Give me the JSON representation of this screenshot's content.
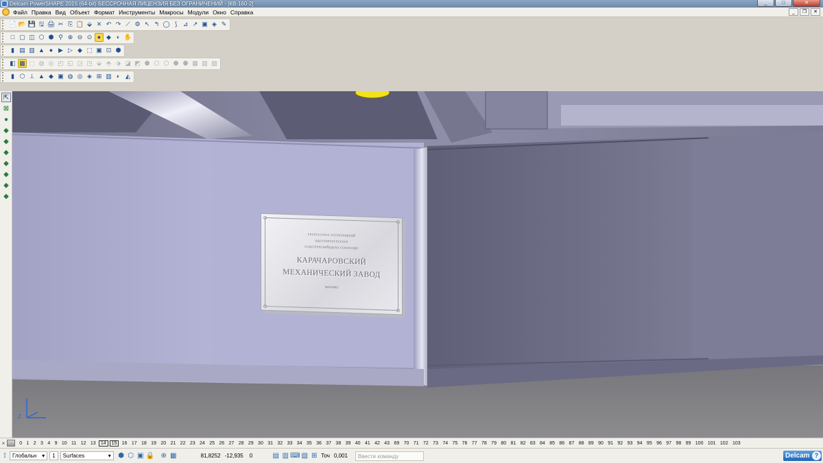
{
  "window": {
    "title": "Delcam PowerSHAPE 2015 (64-bit) БЕССРОЧНАЯ ЛИЦЕНЗИЯ БЕЗ ОГРАНИЧЕНИЙ - [КВ-160-2]",
    "minimize": "_",
    "maximize": "□",
    "close": "✕"
  },
  "menu": {
    "items": [
      "Файл",
      "Правка",
      "Вид",
      "Объект",
      "Формат",
      "Инструменты",
      "Макросы",
      "Модули",
      "Окно",
      "Справка"
    ],
    "mdi_minimize": "_",
    "mdi_restore": "❐",
    "mdi_close": "✕"
  },
  "toolbars": {
    "row1": [
      "📄",
      "📂",
      "💾",
      "🖫",
      "🖨",
      "✂",
      "⎘",
      "📋",
      "⬙",
      "✕",
      "↶",
      "↷",
      "⟋",
      "⚙",
      "↖",
      "↰",
      "◯",
      "⟆",
      "⊿",
      "↗",
      "▣",
      "◈",
      "✎"
    ],
    "row2": [
      "□",
      "▢",
      "◫",
      "⬡",
      "⬢",
      "⚲",
      "⊕",
      "⊖",
      "⊙",
      "●",
      "◆",
      "◐",
      "✋"
    ],
    "row3": [
      "▮",
      "▤",
      "▥",
      "▲",
      "●",
      "▶",
      "▷",
      "◆",
      "⬚",
      "▣",
      "⊡",
      "⬢"
    ],
    "row4": [
      "◧",
      "▩",
      "⬚",
      "◍",
      "◎",
      "◰",
      "◱",
      "◲",
      "◳",
      "⬙",
      "⬘",
      "⬗",
      "◪",
      "◩",
      "⬟",
      "⬠",
      "⬡",
      "⬢",
      "⬣",
      "▦",
      "▧",
      "▨"
    ],
    "row5": [
      "▮",
      "⬡",
      "⟂",
      "▲",
      "◆",
      "▣",
      "◍",
      "◎",
      "◈",
      "⊞",
      "▥",
      "◐",
      "◭"
    ]
  },
  "left_toolbar": [
    "⇱",
    "⊠",
    "●",
    "◆",
    "◆",
    "◆",
    "◆",
    "◆",
    "◆",
    "◆"
  ],
  "nameplate": {
    "small_line1": "сесеcсссесс сссеескоуедй",
    "small_line2": "одсссоосусессосе",
    "small_line3": "ссдссеечсаебудска ссесесорс",
    "title_line1": "КАРАЧАРОВСКИЙ",
    "title_line2": "МЕХАНИЧЕСКИЙ ЗАВОД",
    "city": "москва"
  },
  "axis": {
    "z_label": "Z"
  },
  "layers": {
    "numbers": [
      "0",
      "1",
      "2",
      "3",
      "4",
      "9",
      "10",
      "11",
      "12",
      "13",
      "14",
      "15",
      "16",
      "17",
      "18",
      "19",
      "20",
      "21",
      "22",
      "23",
      "24",
      "25",
      "26",
      "27",
      "28",
      "29",
      "30",
      "31",
      "32",
      "33",
      "34",
      "35",
      "36",
      "37",
      "38",
      "39",
      "40",
      "41",
      "42",
      "43",
      "69",
      "70",
      "71",
      "72",
      "73",
      "74",
      "75",
      "76",
      "77",
      "78",
      "79",
      "80",
      "81",
      "82",
      "83",
      "84",
      "85",
      "86",
      "87",
      "88",
      "89",
      "90",
      "91",
      "92",
      "93",
      "94",
      "95",
      "96",
      "97",
      "98",
      "99",
      "100",
      "101",
      "102",
      "103"
    ],
    "boxed": [
      "14",
      "15"
    ]
  },
  "status": {
    "workplane": "Глобальн",
    "level": "1",
    "surface_mode": "Surfaces",
    "x": "81,8252",
    "y": "-12,935",
    "z": "0",
    "tolerance_label": "Точ",
    "tolerance": "0,001",
    "command_placeholder": "Ввести команду",
    "logo": "Delcam",
    "help": "?"
  }
}
